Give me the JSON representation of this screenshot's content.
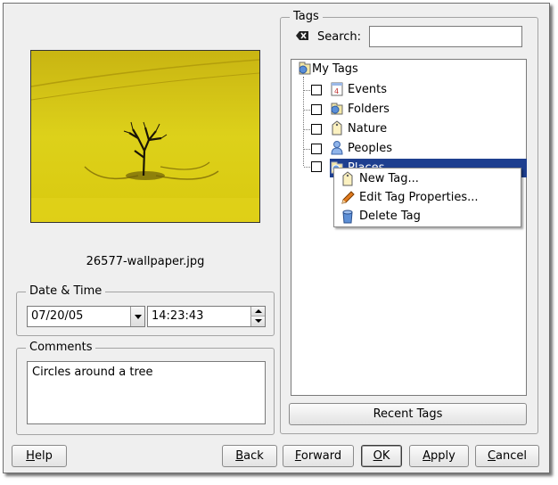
{
  "image": {
    "filename": "26577-wallpaper.jpg"
  },
  "datetime": {
    "title": "Date & Time",
    "date": "07/20/05",
    "time": "14:23:43"
  },
  "comments": {
    "title": "Comments",
    "text": "Circles around a tree"
  },
  "tags": {
    "title": "Tags",
    "search_label": "Search:",
    "search_value": "",
    "root": "My Tags",
    "items": [
      {
        "label": "Events",
        "icon": "calendar-tag-icon",
        "checked": false
      },
      {
        "label": "Folders",
        "icon": "folder-tag-icon",
        "checked": false
      },
      {
        "label": "Nature",
        "icon": "tag-icon",
        "checked": false
      },
      {
        "label": "Peoples",
        "icon": "person-tag-icon",
        "checked": false
      },
      {
        "label": "Places",
        "icon": "globe-tag-icon",
        "checked": false,
        "selected": true
      }
    ],
    "recent_button": "Recent Tags"
  },
  "context_menu": [
    {
      "label": "New Tag...",
      "icon": "new-tag-icon"
    },
    {
      "label": "Edit Tag Properties...",
      "icon": "pencil-icon"
    },
    {
      "label": "Delete Tag",
      "icon": "delete-tag-icon"
    }
  ],
  "buttons": {
    "help": {
      "label": "Help",
      "mnemonic": "H",
      "rest": "elp"
    },
    "back": {
      "label": "Back",
      "mnemonic": "B",
      "rest": "ack"
    },
    "forward": {
      "label": "Forward",
      "mnemonic": "F",
      "rest": "orward"
    },
    "ok": {
      "label": "OK",
      "mnemonic": "O",
      "rest": "K"
    },
    "apply": {
      "label": "Apply",
      "mnemonic": "A",
      "rest": "pply"
    },
    "cancel": {
      "label": "Cancel",
      "mnemonic": "C",
      "rest": "ancel"
    }
  },
  "colors": {
    "selection": "#1e3f8f",
    "window_bg": "#efefef"
  }
}
